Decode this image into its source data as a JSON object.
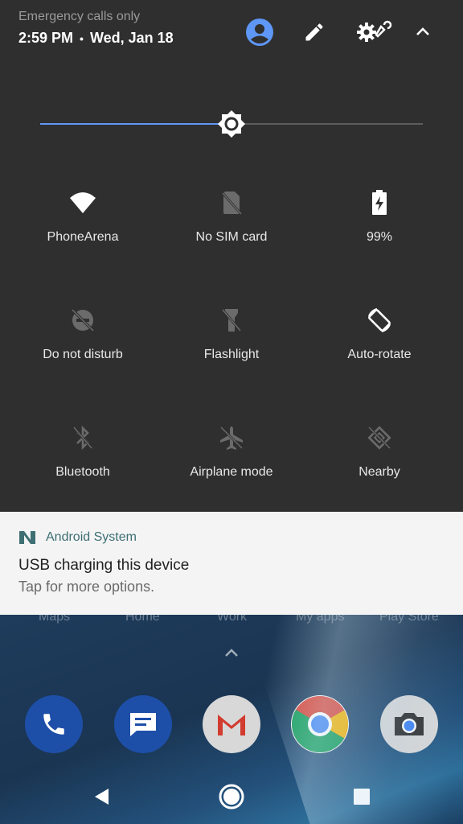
{
  "status": {
    "emergency": "Emergency calls only",
    "time": "2:59 PM",
    "separator": "•",
    "date": "Wed, Jan 18"
  },
  "header_icons": [
    "avatar-icon",
    "edit-icon",
    "settings-icon",
    "collapse-icon"
  ],
  "brightness": {
    "level": 0.5,
    "accent": "#5e97f6"
  },
  "tiles": [
    {
      "label": "PhoneArena",
      "icon": "wifi-icon",
      "active": true
    },
    {
      "label": "No SIM card",
      "icon": "no-sim-icon",
      "active": false
    },
    {
      "label": "99%",
      "icon": "battery-charging-icon",
      "active": true
    },
    {
      "label": "Do not disturb",
      "icon": "dnd-off-icon",
      "active": false
    },
    {
      "label": "Flashlight",
      "icon": "flashlight-off-icon",
      "active": false
    },
    {
      "label": "Auto-rotate",
      "icon": "auto-rotate-icon",
      "active": true
    },
    {
      "label": "Bluetooth",
      "icon": "bluetooth-off-icon",
      "active": false
    },
    {
      "label": "Airplane mode",
      "icon": "airplane-off-icon",
      "active": false
    },
    {
      "label": "Nearby",
      "icon": "nearby-off-icon",
      "active": false
    }
  ],
  "notification": {
    "app": "Android System",
    "title": "USB charging this device",
    "text": "Tap for more options."
  },
  "home": {
    "shortcuts": [
      "Maps",
      "Home",
      "Work",
      "My apps",
      "Play Store"
    ],
    "dock": [
      "phone-app-icon",
      "messages-app-icon",
      "gmail-app-icon",
      "chrome-app-icon",
      "camera-app-icon"
    ]
  },
  "nav": [
    "back-button",
    "home-button",
    "recents-button"
  ]
}
